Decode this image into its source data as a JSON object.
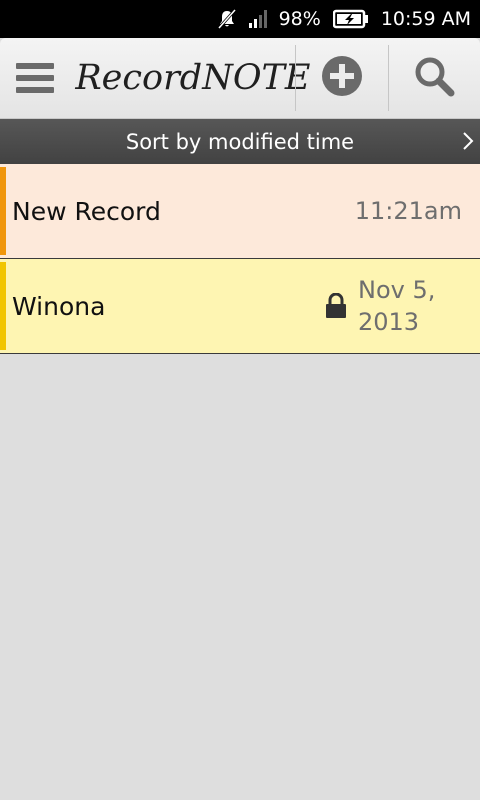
{
  "status_bar": {
    "battery_percent": "98%",
    "time": "10:59 AM",
    "icons": [
      "mute-icon",
      "signal-icon",
      "battery-charging-icon"
    ]
  },
  "action_bar": {
    "app_title": "RecordNOTE",
    "icons": [
      "menu-icon",
      "add-icon",
      "search-icon"
    ]
  },
  "sort_bar": {
    "label": "Sort by modified time",
    "icon": "chevron-right-icon"
  },
  "records": [
    {
      "title": "New Record",
      "modified": "11:21am",
      "locked": false,
      "color": "#f0960c",
      "background": "#fde9da"
    },
    {
      "title": "Winona",
      "modified": "Nov 5, 2013",
      "locked": true,
      "color": "#f1c500",
      "background": "#fef5b2"
    }
  ],
  "colors": {
    "status_bar_bg": "#000000",
    "sort_bar_bg": "#4a4a4a",
    "list_bg": "#dedede",
    "icon_gray": "#6a6a6a"
  }
}
